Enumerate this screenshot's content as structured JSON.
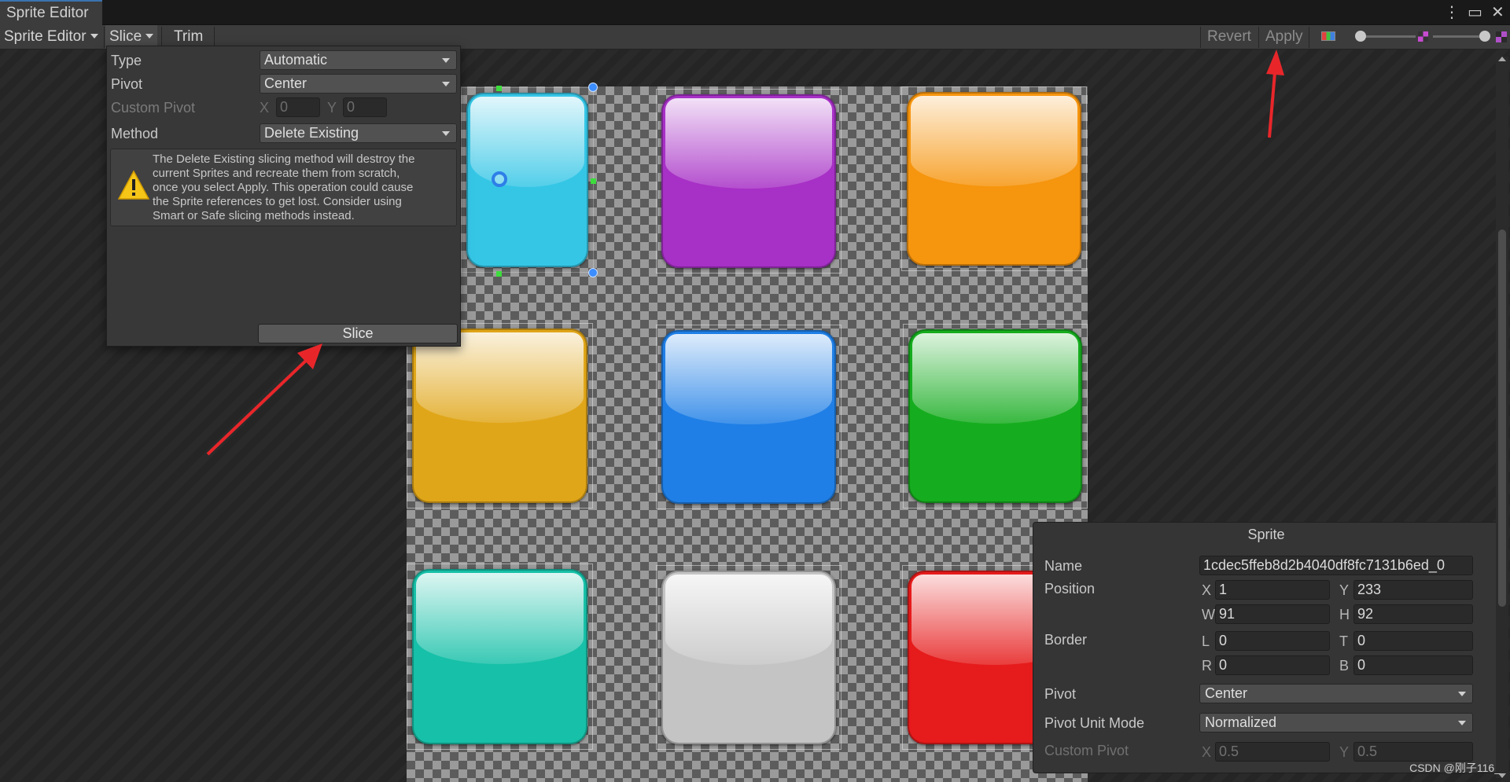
{
  "window": {
    "title": "Sprite Editor",
    "menu_icon": "kebab-icon",
    "maximize_icon": "maximize-icon",
    "close_icon": "close-icon"
  },
  "toolbar": {
    "mode_label": "Sprite Editor",
    "slice_label": "Slice",
    "trim_label": "Trim",
    "revert_label": "Revert",
    "apply_label": "Apply"
  },
  "slice_popup": {
    "type_label": "Type",
    "type_value": "Automatic",
    "pivot_label": "Pivot",
    "pivot_value": "Center",
    "custom_pivot_label": "Custom Pivot",
    "x_label": "X",
    "x_value": "0",
    "y_label": "Y",
    "y_value": "0",
    "method_label": "Method",
    "method_value": "Delete Existing",
    "help_lines": [
      "The Delete Existing slicing method will destroy the",
      "current Sprites and recreate them from scratch,",
      "once you select Apply. This operation could cause",
      "the Sprite references to get lost. Consider using",
      "Smart or Safe slicing methods instead."
    ],
    "slice_button": "Slice"
  },
  "sprites": {
    "colors": [
      "#35c6e6",
      "#a730c6",
      "#f6950e",
      "#e0a619",
      "#1f7fe6",
      "#16ac1f",
      "#17c0a8",
      "#c4c4c4",
      "#e61b1b"
    ]
  },
  "sprite_panel": {
    "title": "Sprite",
    "name_label": "Name",
    "name_value": "1cdec5ffeb8d2b4040df8fc7131b6ed_0",
    "position_label": "Position",
    "x_label": "X",
    "x_value": "1",
    "y_label": "Y",
    "y_value": "233",
    "w_label": "W",
    "w_value": "91",
    "h_label": "H",
    "h_value": "92",
    "border_label": "Border",
    "l_label": "L",
    "l_value": "0",
    "t_label": "T",
    "t_value": "0",
    "r_label": "R",
    "r_value": "0",
    "b_label": "B",
    "b_value": "0",
    "pivot_label": "Pivot",
    "pivot_value": "Center",
    "pivot_unit_label": "Pivot Unit Mode",
    "pivot_unit_value": "Normalized",
    "custom_pivot_label": "Custom Pivot",
    "cp_x_label": "X",
    "cp_x_value": "0.5",
    "cp_y_label": "Y",
    "cp_y_value": "0.5"
  },
  "watermark": "CSDN @刚子116_",
  "annotation_color": "#e8262a"
}
